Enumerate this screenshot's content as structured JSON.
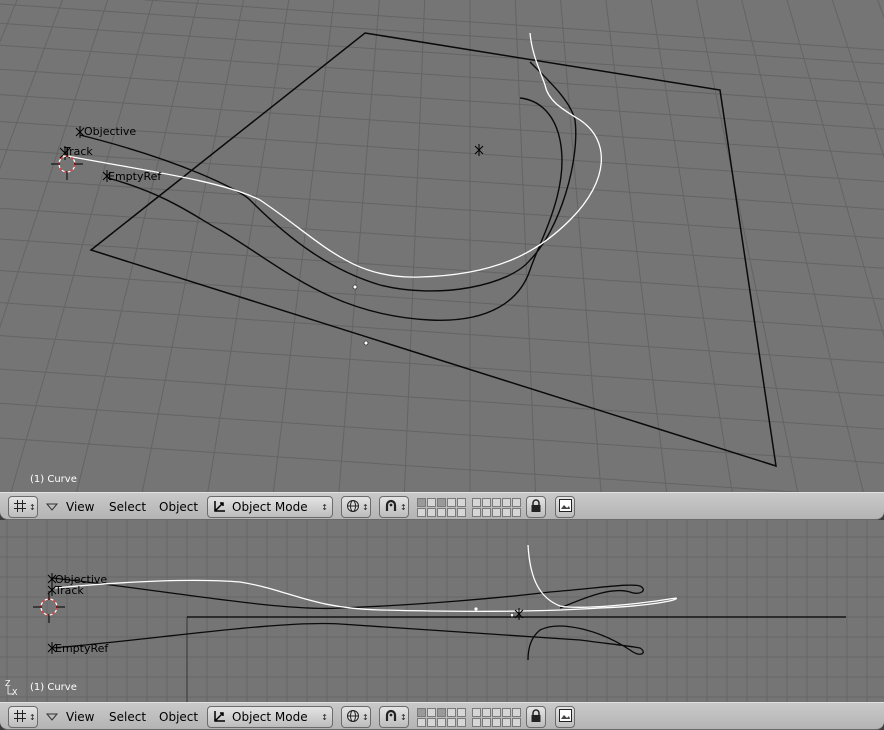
{
  "scene": {
    "labels": {
      "objective": "Objective",
      "track": "Track",
      "empty_ref": "EmptyRef"
    }
  },
  "top_viewport": {
    "info": "(1) Curve"
  },
  "bottom_viewport": {
    "info": "(1) Curve",
    "axis_z": "Z",
    "axis_x": "X"
  },
  "header": {
    "menus": {
      "view": "View",
      "select": "Select",
      "object": "Object"
    },
    "mode": "Object Mode"
  },
  "icons": {
    "editor_type": "grid-editor-icon",
    "shading": "solid-sphere-icon",
    "snap": "magnet-icon",
    "lock": "lock-icon",
    "render": "image-icon"
  },
  "colors": {
    "viewport_bg": "#757575",
    "grid": "#666666",
    "header_bg": "#c4c4c4",
    "selected_curve": "#ffffff",
    "curve": "#101010"
  }
}
